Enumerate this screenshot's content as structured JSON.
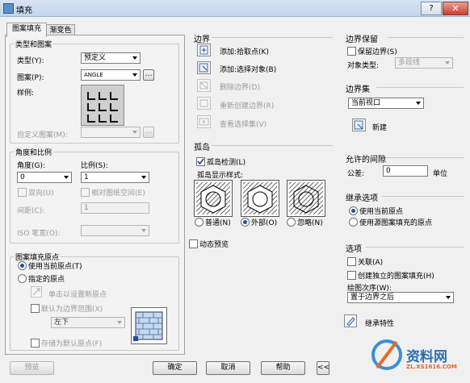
{
  "window": {
    "title": "填充",
    "help_label": "?",
    "close_label": "✕"
  },
  "tabs": [
    {
      "label": "图案填充"
    },
    {
      "label": "渐变色"
    }
  ],
  "type_pattern": {
    "group_label": "类型和图案",
    "type_label": "类型(Y):",
    "type_value": "预定义",
    "pattern_label": "图案(P):",
    "pattern_value": "ANGLE",
    "swatch_label": "样例:",
    "custom_label": "自定义图案(M):"
  },
  "angle_scale": {
    "group_label": "角度和比例",
    "angle_label": "角度(G):",
    "angle_value": "0",
    "scale_label": "比例(S):",
    "scale_value": "1",
    "double_label": "双向(U)",
    "relative_label": "相对图纸空间(E)",
    "spacing_label": "间距(C):",
    "spacing_value": "1",
    "iso_label": "ISO 笔宽(O):"
  },
  "origin": {
    "group_label": "图案填充原点",
    "use_current_label": "使用当前原点(T)",
    "specified_label": "指定的原点",
    "click_set_label": "单击以设置新原点",
    "default_extent_label": "默认为边界范围(X)",
    "position_value": "左下",
    "store_default_label": "存储为默认原点(F)"
  },
  "boundary": {
    "group_label": "边界",
    "add_pick_label": "添加:拾取点(K)",
    "add_select_label": "添加:选择对象(B)",
    "remove_label": "删除边界(D)",
    "recreate_label": "重新创建边界(R)",
    "view_label": "查看选择集(V)"
  },
  "islands": {
    "group_label": "孤岛",
    "detect_label": "孤岛检测(L)",
    "style_label": "孤岛显示样式:",
    "normal_label": "普通(N)",
    "outer_label": "外部(O)",
    "ignore_label": "忽略(N)"
  },
  "annotative_label": "动态预览",
  "boundary_retention": {
    "group_label": "边界保留",
    "retain_label": "保留边界(S)",
    "object_type_label": "对象类型:",
    "object_type_value": "多段线"
  },
  "boundary_set": {
    "group_label": "边界集",
    "value": "当前视口",
    "new_label": "新建"
  },
  "gap": {
    "group_label": "允许的间隙",
    "tolerance_label": "公差:",
    "tolerance_value": "0",
    "unit_label": "单位"
  },
  "inherit_options": {
    "group_label": "继承选项",
    "use_current_label": "使用当前原点",
    "use_source_label": "使用源图案填充的原点"
  },
  "options": {
    "group_label": "选项",
    "associative_label": "关联(A)",
    "separate_label": "创建独立的图案填充(H)",
    "draw_order_label": "绘图次序(W):",
    "draw_order_value": "置于边界之后"
  },
  "inherit_label": "继承特性",
  "bottom": {
    "preview": "预览",
    "ok": "确定",
    "cancel": "取消",
    "help": "帮助",
    "collapse": "<<"
  },
  "watermark": {
    "site": "资料网",
    "url": "ZL.XS1616.COM"
  }
}
